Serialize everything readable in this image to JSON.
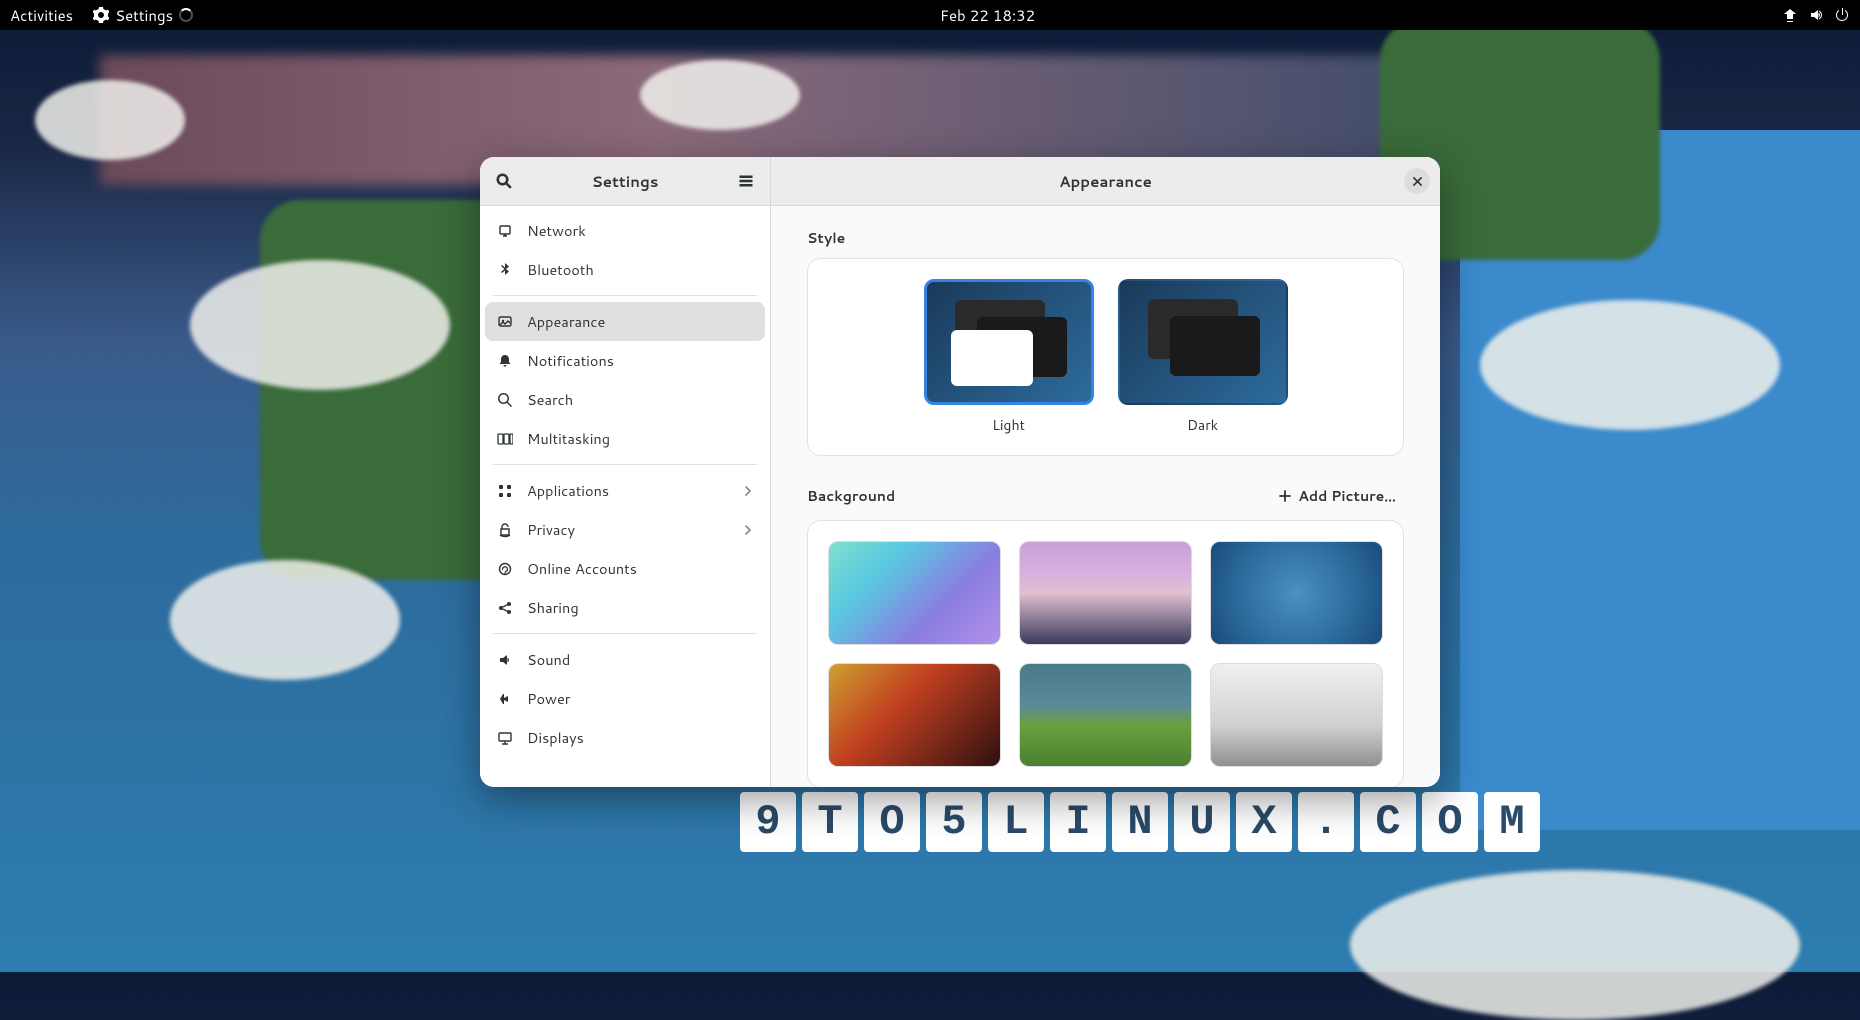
{
  "panel": {
    "activities": "Activities",
    "app_name": "Settings",
    "clock": "Feb 22  18:32"
  },
  "window": {
    "sidebar_title": "Settings",
    "content_title": "Appearance",
    "items": [
      {
        "icon": "network",
        "label": "Network"
      },
      {
        "icon": "bluetooth",
        "label": "Bluetooth"
      },
      {
        "sep": true
      },
      {
        "icon": "appearance",
        "label": "Appearance",
        "selected": true
      },
      {
        "icon": "bell",
        "label": "Notifications"
      },
      {
        "icon": "search",
        "label": "Search"
      },
      {
        "icon": "multitask",
        "label": "Multitasking"
      },
      {
        "sep": true
      },
      {
        "icon": "apps",
        "label": "Applications",
        "chevron": true
      },
      {
        "icon": "privacy",
        "label": "Privacy",
        "chevron": true
      },
      {
        "icon": "online",
        "label": "Online Accounts"
      },
      {
        "icon": "share",
        "label": "Sharing"
      },
      {
        "sep": true
      },
      {
        "icon": "sound",
        "label": "Sound"
      },
      {
        "icon": "power",
        "label": "Power"
      },
      {
        "icon": "display",
        "label": "Displays"
      }
    ]
  },
  "appearance": {
    "style_heading": "Style",
    "styles": [
      {
        "label": "Light",
        "selected": true
      },
      {
        "label": "Dark",
        "selected": false
      }
    ],
    "background_heading": "Background",
    "add_picture_label": "Add Picture…"
  },
  "watermark": "9TO5LINUX.COM"
}
